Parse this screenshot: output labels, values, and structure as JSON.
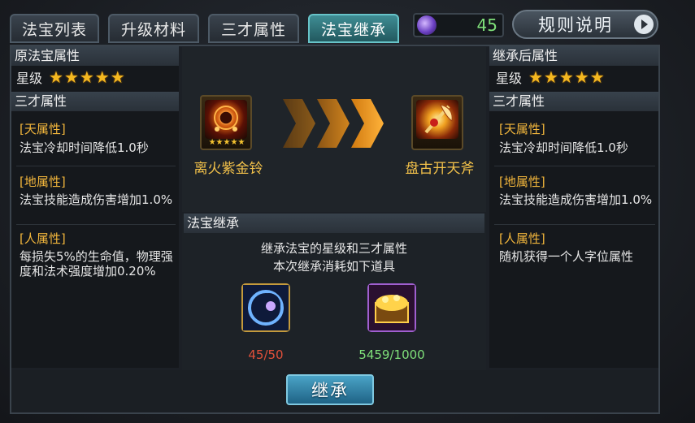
{
  "tabs": [
    {
      "label": "法宝列表",
      "active": false
    },
    {
      "label": "升级材料",
      "active": false
    },
    {
      "label": "三才属性",
      "active": false
    },
    {
      "label": "法宝继承",
      "active": true
    }
  ],
  "currency": {
    "value": "45",
    "icon": "purple-orb-icon"
  },
  "rules_button": {
    "label": "规则说明",
    "icon": "play-arrow-icon"
  },
  "left": {
    "header": "原法宝属性",
    "star_label": "星级",
    "stars": "★★★★★",
    "sancai_header": "三才属性",
    "attrs": [
      {
        "title": "[天属性]",
        "text": "法宝冷却时间降低1.0秒"
      },
      {
        "title": "[地属性]",
        "text": "法宝技能造成伤害增加1.0%"
      },
      {
        "title": "[人属性]",
        "text": "每损失5%的生命值，物理强度和法术强度增加0.20%"
      }
    ]
  },
  "right": {
    "header": "继承后属性",
    "star_label": "星级",
    "stars": "★★★★★",
    "sancai_header": "三才属性",
    "attrs": [
      {
        "title": "[天属性]",
        "text": "法宝冷却时间降低1.0秒"
      },
      {
        "title": "[地属性]",
        "text": "法宝技能造成伤害增加1.0%"
      },
      {
        "title": "[人属性]",
        "text": "随机获得一个人字位属性"
      }
    ]
  },
  "source_item": {
    "name": "离火紫金铃",
    "stars": "★★★★★",
    "icon": "bell-treasure-icon"
  },
  "target_item": {
    "name": "盘古开天斧",
    "icon": "axe-treasure-icon"
  },
  "inherit_section": {
    "header": "法宝继承",
    "line1": "继承法宝的星级和三才属性",
    "line2": "本次继承消耗如下道具"
  },
  "materials": [
    {
      "icon": "moon-orb-icon",
      "count": "45/50",
      "color": "#e0503a"
    },
    {
      "icon": "treasure-chest-icon",
      "count": "5459/1000",
      "color": "#7fe07a"
    }
  ],
  "inherit_button": {
    "label": "继承"
  },
  "colors": {
    "accent": "#67c3c8",
    "gold": "#f2b63c",
    "green": "#7fe07a",
    "red": "#e0503a"
  }
}
